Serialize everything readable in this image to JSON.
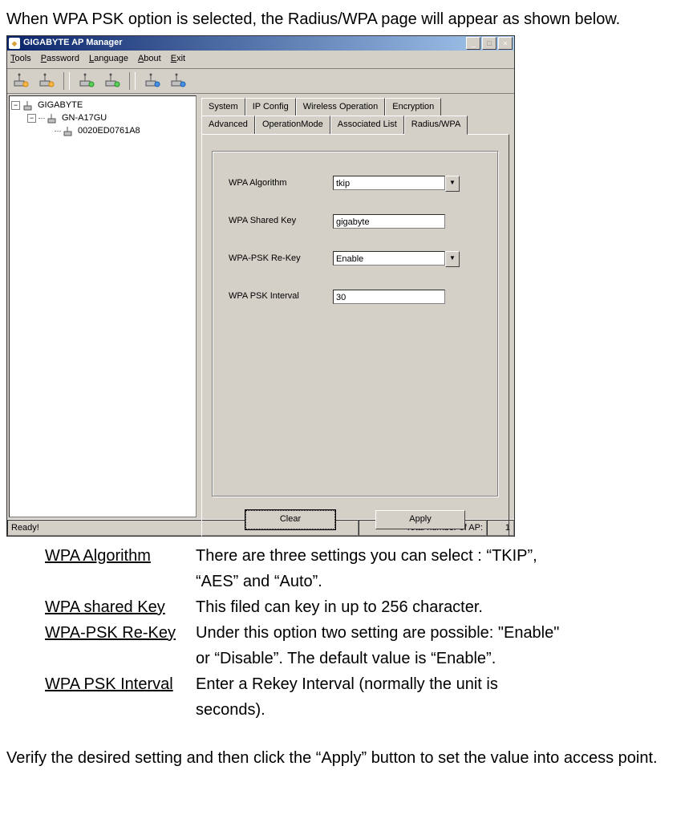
{
  "intro": "When WPA PSK option is selected, the Radius/WPA page will appear as shown below.",
  "window": {
    "title": "GIGABYTE AP Manager",
    "menus": {
      "tools": "Tools",
      "password": "Password",
      "language": "Language",
      "about": "About",
      "exit": "Exit"
    },
    "tree": {
      "root": "GIGABYTE",
      "child": "GN-A17GU",
      "leaf": "0020ED0761A8"
    },
    "tabs": {
      "row1": {
        "system": "System",
        "ipconfig": "IP Config",
        "wireless": "Wireless Operation",
        "encryption": "Encryption"
      },
      "row2": {
        "advanced": "Advanced",
        "opmode": "OperationMode",
        "assoc": "Associated List",
        "radius": "Radius/WPA"
      }
    },
    "form": {
      "algo_label": "WPA Algorithm",
      "algo_value": "tkip",
      "key_label": "WPA Shared Key",
      "key_value": "gigabyte",
      "rekey_label": "WPA-PSK Re-Key",
      "rekey_value": "Enable",
      "interval_label": "WPA PSK Interval",
      "interval_value": "30"
    },
    "buttons": {
      "clear": "Clear",
      "apply": "Apply"
    },
    "status": {
      "ready": "Ready!",
      "total_label": "Total number of AP:",
      "total_value": "1"
    }
  },
  "defs": {
    "algo": {
      "term": "WPA Algorithm",
      "desc1": "There are three settings you can select : “TKIP”,",
      "desc2": "“AES” and “Auto”."
    },
    "key": {
      "term": "WPA shared Key",
      "desc": "This filed can key in up to 256 character."
    },
    "rekey": {
      "term": "WPA-PSK Re-Key",
      "desc1": "Under this option two setting are possible: \"Enable\"",
      "desc2": "or “Disable”. The default value is “Enable”."
    },
    "interval": {
      "term": "WPA PSK Interval",
      "desc1": "Enter a Rekey Interval (normally the unit is",
      "desc2": "seconds)."
    }
  },
  "outro": "Verify the desired setting and then click the “Apply” button to set the value into access point."
}
